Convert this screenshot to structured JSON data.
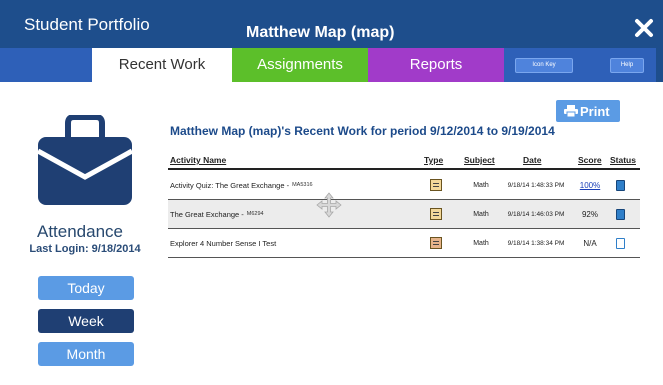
{
  "header": {
    "app_title": "Student Portfolio",
    "student_name": "Matthew Map (map)"
  },
  "tabs": [
    {
      "label": "Recent Work"
    },
    {
      "label": "Assignments"
    },
    {
      "label": "Reports"
    }
  ],
  "header_pills": {
    "icon_key": "Icon Key",
    "help": "Help"
  },
  "sidebar": {
    "icon": "briefcase-icon",
    "attendance_title": "Attendance",
    "last_login": "Last Login: 9/18/2014",
    "buttons": [
      {
        "label": "Today"
      },
      {
        "label": "Week"
      },
      {
        "label": "Month"
      }
    ]
  },
  "main": {
    "print_label": "Print",
    "heading": "Matthew Map (map)'s Recent Work for period 9/12/2014 to 9/19/2014",
    "columns": [
      "Activity Name",
      "Type",
      "Subject",
      "Date",
      "Score",
      "Status"
    ],
    "rows": [
      {
        "name": "Activity Quiz: The Great Exchange -",
        "code": "MA5316",
        "subject": "Math",
        "date": "9/18/14 1:48:33 PM",
        "score": "100%"
      },
      {
        "name": "The Great Exchange -",
        "code": "M6294",
        "subject": "Math",
        "date": "9/18/14 1:46:03 PM",
        "score": "92%"
      },
      {
        "name": "Explorer 4 Number Sense I Test",
        "code": "",
        "subject": "Math",
        "date": "9/18/14 1:38:34 PM",
        "score": "N/A"
      }
    ]
  },
  "colors": {
    "title_bar": "#1e4e8c",
    "tab_assignments": "#5cbf2a",
    "tab_reports": "#a13bc9",
    "button_light": "#5b9be4",
    "button_selected": "#1f3f73"
  }
}
